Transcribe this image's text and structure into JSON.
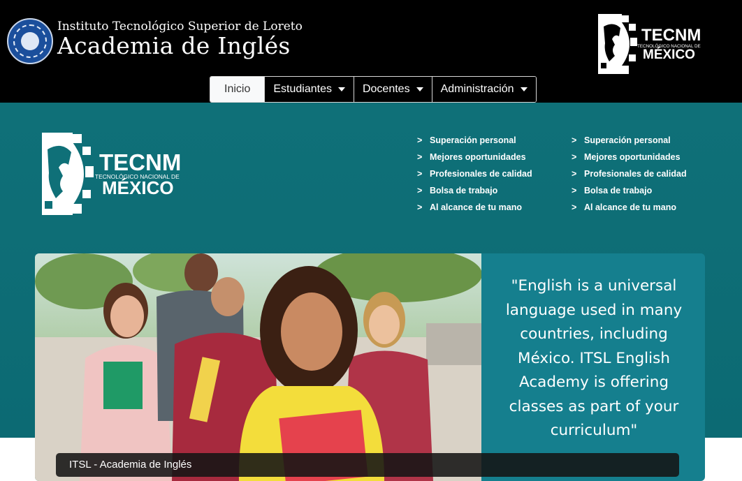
{
  "header": {
    "institute_name": "Instituto Tecnológico Superior de Loreto",
    "academy_name": "Academia de Inglés",
    "seal_icon": "institute-seal-logo",
    "brand_logo": {
      "word": "TECNM",
      "subtitle": "TECNOLÓGICO NACIONAL DE",
      "country": "MÉXICO"
    }
  },
  "nav": {
    "items": [
      {
        "label": "Inicio",
        "active": true,
        "dropdown": false
      },
      {
        "label": "Estudiantes",
        "active": false,
        "dropdown": true
      },
      {
        "label": "Docentes",
        "active": false,
        "dropdown": true
      },
      {
        "label": "Administración",
        "active": false,
        "dropdown": true
      }
    ]
  },
  "benefits": {
    "col1": [
      "Superación personal",
      "Mejores oportunidades",
      "Profesionales de calidad",
      "Bolsa de trabajo",
      "Al alcance de tu mano"
    ],
    "col2": [
      "Superación personal",
      "Mejores oportunidades",
      "Profesionales de calidad",
      "Bolsa de trabajo",
      "Al alcance de tu mano"
    ],
    "bullet": ">"
  },
  "hero": {
    "quote_lines": [
      "\"English is a universal",
      "language used in many",
      "countries, including",
      "México. ITSL English",
      "Academy is offering",
      "classes as part of your",
      "curriculum\""
    ],
    "caption": "ITSL - Academia de Inglés"
  },
  "colors": {
    "header_bg": "#000000",
    "teal_band": "#0f7078",
    "card_teal": "#157f8e",
    "nav_active_bg": "#f8f9fa"
  }
}
